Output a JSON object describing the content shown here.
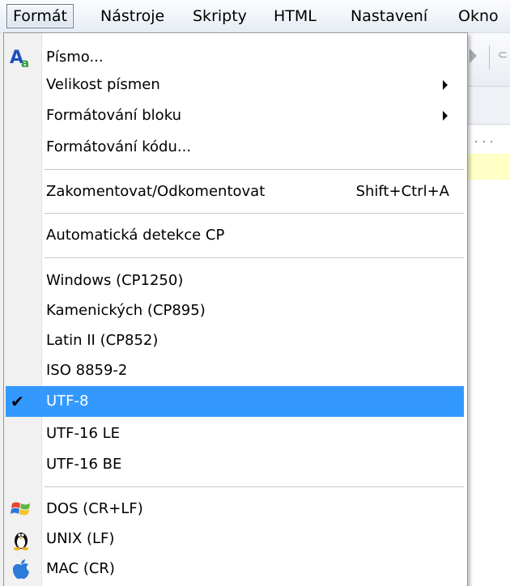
{
  "menubar": {
    "items": [
      {
        "label": "Formát",
        "active": true
      },
      {
        "label": "Nástroje"
      },
      {
        "label": "Skripty"
      },
      {
        "label": "HTML"
      },
      {
        "label": "Nastavení"
      },
      {
        "label": "Okno"
      }
    ]
  },
  "menu": {
    "font": {
      "label": "Písmo..."
    },
    "font_size": {
      "label": "Velikost písmen"
    },
    "block_format": {
      "label": "Formátování bloku"
    },
    "code_format": {
      "label": "Formátování kódu..."
    },
    "comment_toggle": {
      "label": "Zakomentovat/Odkomentovat",
      "shortcut": "Shift+Ctrl+A"
    },
    "auto_detect": {
      "label": "Automatická detekce CP"
    },
    "encodings": [
      {
        "label": "Windows (CP1250)"
      },
      {
        "label": "Kamenických (CP895)"
      },
      {
        "label": "Latin II (CP852)"
      },
      {
        "label": "ISO 8859-2"
      },
      {
        "label": "UTF-8",
        "checked": true,
        "selected": true
      },
      {
        "label": "UTF-16 LE"
      },
      {
        "label": "UTF-16 BE"
      }
    ],
    "line_endings": [
      {
        "label": "DOS  (CR+LF)",
        "icon": "windows-icon"
      },
      {
        "label": "UNIX  (LF)",
        "icon": "linux-tux-icon"
      },
      {
        "label": "MAC  (CR)",
        "icon": "apple-icon"
      }
    ]
  },
  "colors": {
    "selection": "#3399ff",
    "gutter": "#f1f1f1",
    "editor_highlight": "#ffffc6"
  }
}
